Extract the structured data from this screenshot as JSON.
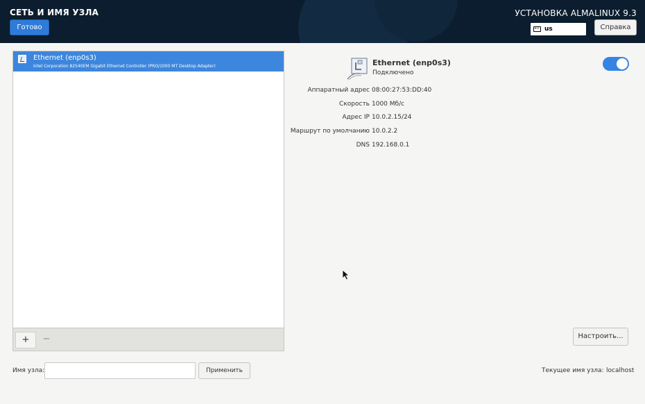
{
  "header": {
    "title": "СЕТЬ И ИМЯ УЗЛА",
    "done_label": "Готово",
    "product": "УСТАНОВКА ALMALINUX 9.3",
    "keyboard_layout": "us",
    "help_label": "Справка",
    "background_color": "#0b1d2e",
    "accent_color": "#2f7bd8"
  },
  "device_list": {
    "items": [
      {
        "name": "Ethernet (enp0s3)",
        "description": "Intel Corporation 82540EM Gigabit Ethernet Controller (PRO/1000 MT Desktop Adapter)",
        "selected": true,
        "icon": "network-wired-icon"
      }
    ],
    "add_label": "+",
    "remove_label": "−"
  },
  "device_detail": {
    "title": "Ethernet (enp0s3)",
    "status": "Подключено",
    "enabled": true,
    "rows": [
      {
        "key": "Аппаратный адрес",
        "value": "08:00:27:53:DD:40"
      },
      {
        "key": "Скорость",
        "value": "1000 Мб/с"
      },
      {
        "key": "Адрес IP",
        "value": "10.0.2.15/24"
      },
      {
        "key": "Маршрут по умолчанию",
        "value": "10.0.2.2"
      },
      {
        "key": "DNS",
        "value": "192.168.0.1"
      }
    ],
    "configure_label": "Настроить..."
  },
  "hostname": {
    "label": "Имя узла:",
    "value": "",
    "apply_label": "Применить",
    "current_label": "Текущее имя узла:",
    "current_value": "localhost"
  }
}
